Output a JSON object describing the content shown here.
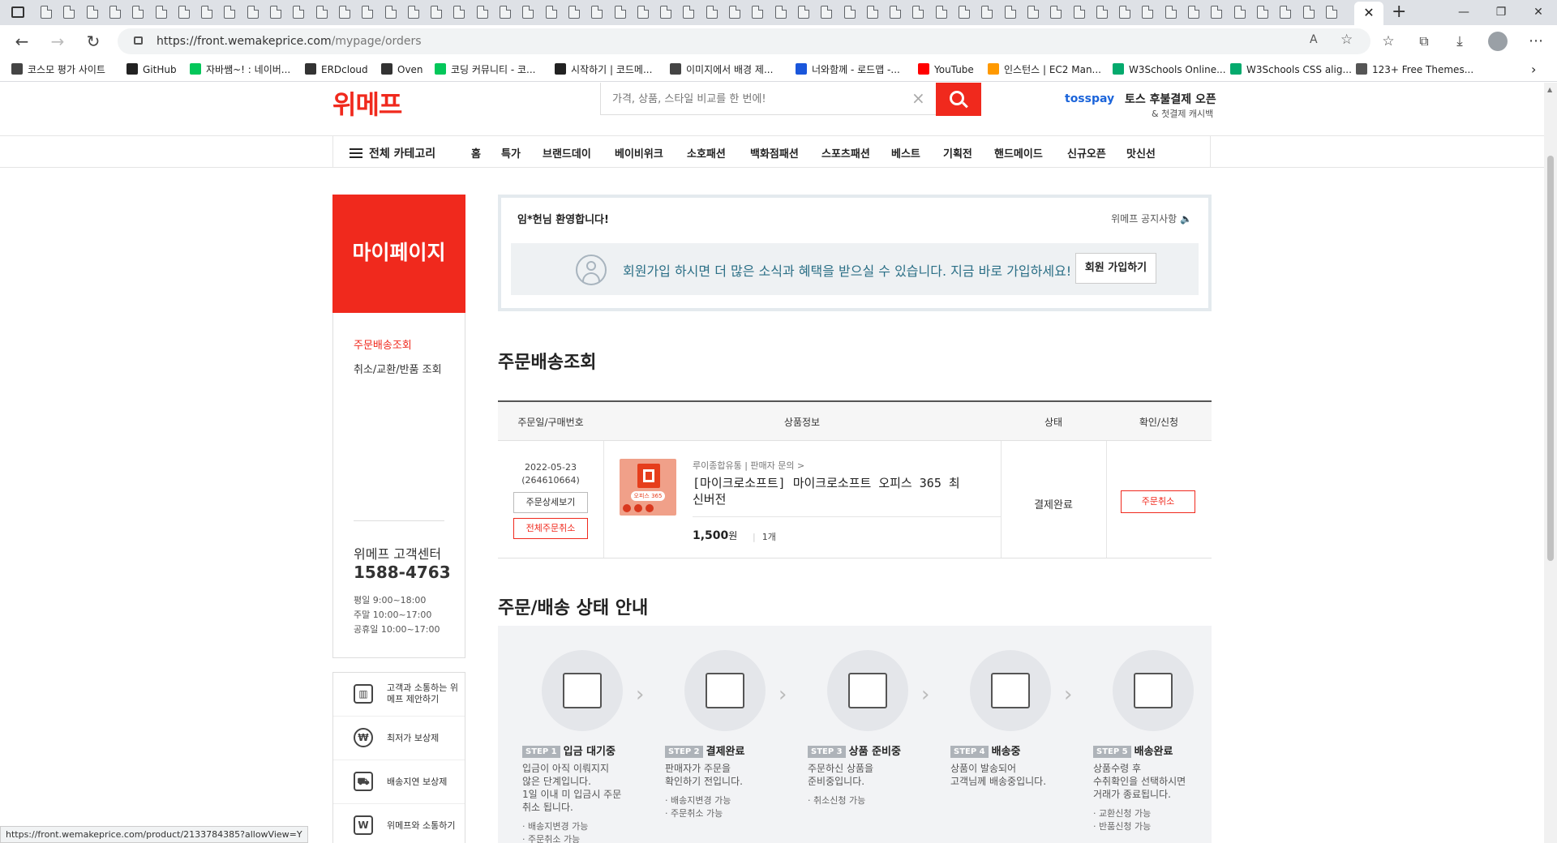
{
  "browser": {
    "url_host": "https://front.wemakeprice.com",
    "url_path": "/mypage/orders",
    "bookmarks": [
      {
        "label": "코스모 평가 사이트",
        "color": "#444444"
      },
      {
        "label": "GitHub",
        "color": "#222222"
      },
      {
        "label": "자바쌤~! : 네이버...",
        "color": "#03c75a"
      },
      {
        "label": "ERDcloud",
        "color": "#333333"
      },
      {
        "label": "Oven",
        "color": "#333333"
      },
      {
        "label": "코딩 커뮤니티 - 코...",
        "color": "#03c75a"
      },
      {
        "label": "시작하기 | 코드메...",
        "color": "#222222"
      },
      {
        "label": "이미지에서 배경 제...",
        "color": "#444444"
      },
      {
        "label": "너와함께 - 로드맵 -...",
        "color": "#1a56db"
      },
      {
        "label": "YouTube",
        "color": "#ff0000"
      },
      {
        "label": "인스턴스 | EC2 Man...",
        "color": "#ff9900"
      },
      {
        "label": "W3Schools Online...",
        "color": "#04aa6d"
      },
      {
        "label": "W3Schools CSS alig...",
        "color": "#04aa6d"
      },
      {
        "label": "123+ Free Themes...",
        "color": "#555555"
      }
    ],
    "status_url": "https://front.wemakeprice.com/product/2133784385?allowView=Y"
  },
  "header": {
    "logo": "위메프",
    "search_placeholder": "가격, 상품, 스타일 비교를 한 번에!",
    "toss_brand": "tosspay",
    "toss_title": "토스 후불결제 오픈",
    "toss_sub": "& 첫결제 캐시백"
  },
  "gnb": {
    "all_category": "전체 카테고리",
    "items": [
      "홈",
      "특가",
      "브랜드데이",
      "베이비위크",
      "소호패션",
      "백화점패션",
      "스포츠패션",
      "베스트",
      "기획전",
      "핸드메이드",
      "신규오픈",
      "맛신선"
    ]
  },
  "sidebar": {
    "title": "마이페이지",
    "links": [
      "주문배송조회",
      "취소/교환/반품 조회"
    ],
    "cs_title": "위메프 고객센터",
    "cs_phone": "1588-4763",
    "cs_hours": [
      "평일 9:00~18:00",
      "주말 10:00~17:00",
      "공휴일 10:00~17:00"
    ],
    "extra_links": [
      {
        "icon": "chart",
        "label": "고객과 소통하는 위메프 제안하기"
      },
      {
        "icon": "₩",
        "label": "최저가 보상제"
      },
      {
        "icon": "truck",
        "label": "배송지연 보상제"
      },
      {
        "icon": "W",
        "label": "위메프와 소통하기"
      }
    ]
  },
  "welcome": {
    "greeting": "임*헌님 환영합니다!",
    "notice": "위메프 공지사항",
    "join_text": "회원가입 하시면 더 많은 소식과 혜택을 받으실 수 있습니다. 지금 바로 가입하세요!",
    "join_button": "회원 가입하기"
  },
  "orders": {
    "title": "주문배송조회",
    "headers": [
      "주문일/구매번호",
      "상품정보",
      "상태",
      "확인/신청"
    ],
    "row": {
      "date": "2022-05-23",
      "order_no": "(264610664)",
      "detail_button": "주문상세보기",
      "cancel_all_button": "전체주문취소",
      "thumb_label": "오피스 365",
      "seller": "루이종합유통  |  판매자 문의 >",
      "product_name": "[마이크로소프트] 마이크로소프트 오피스 365 최신버전",
      "price": "1,500",
      "price_unit": "원",
      "qty": "1개",
      "status": "결제완료",
      "cancel_button": "주문취소"
    }
  },
  "guide": {
    "title": "주문/배송 상태 안내",
    "steps": [
      {
        "badge": "STEP 1",
        "name": "입금 대기중",
        "desc": "입금이 아직 이뤄지지\n않은 단계입니다.\n1일 이내 미 입금시 주문\n취소 됩니다.",
        "notes": "· 배송지변경 가능\n· 주문취소 가능"
      },
      {
        "badge": "STEP 2",
        "name": "결제완료",
        "desc": "판매자가 주문을\n확인하기 전입니다.",
        "notes": "· 배송지변경 가능\n· 주문취소 가능"
      },
      {
        "badge": "STEP 3",
        "name": "상품 준비중",
        "desc": "주문하신 상품을\n준비중입니다.",
        "notes": "· 취소신청 가능"
      },
      {
        "badge": "STEP 4",
        "name": "배송중",
        "desc": "상품이 발송되어\n고객님께 배송중입니다.",
        "notes": ""
      },
      {
        "badge": "STEP 5",
        "name": "배송완료",
        "desc": "상품수령 후\n수취확인을 선택하시면\n거래가 종료됩니다.",
        "notes": "· 교환신청 가능\n· 반품신청 가능"
      }
    ]
  },
  "colors": {
    "brand": "#f0291d",
    "toss": "#1b64da"
  }
}
